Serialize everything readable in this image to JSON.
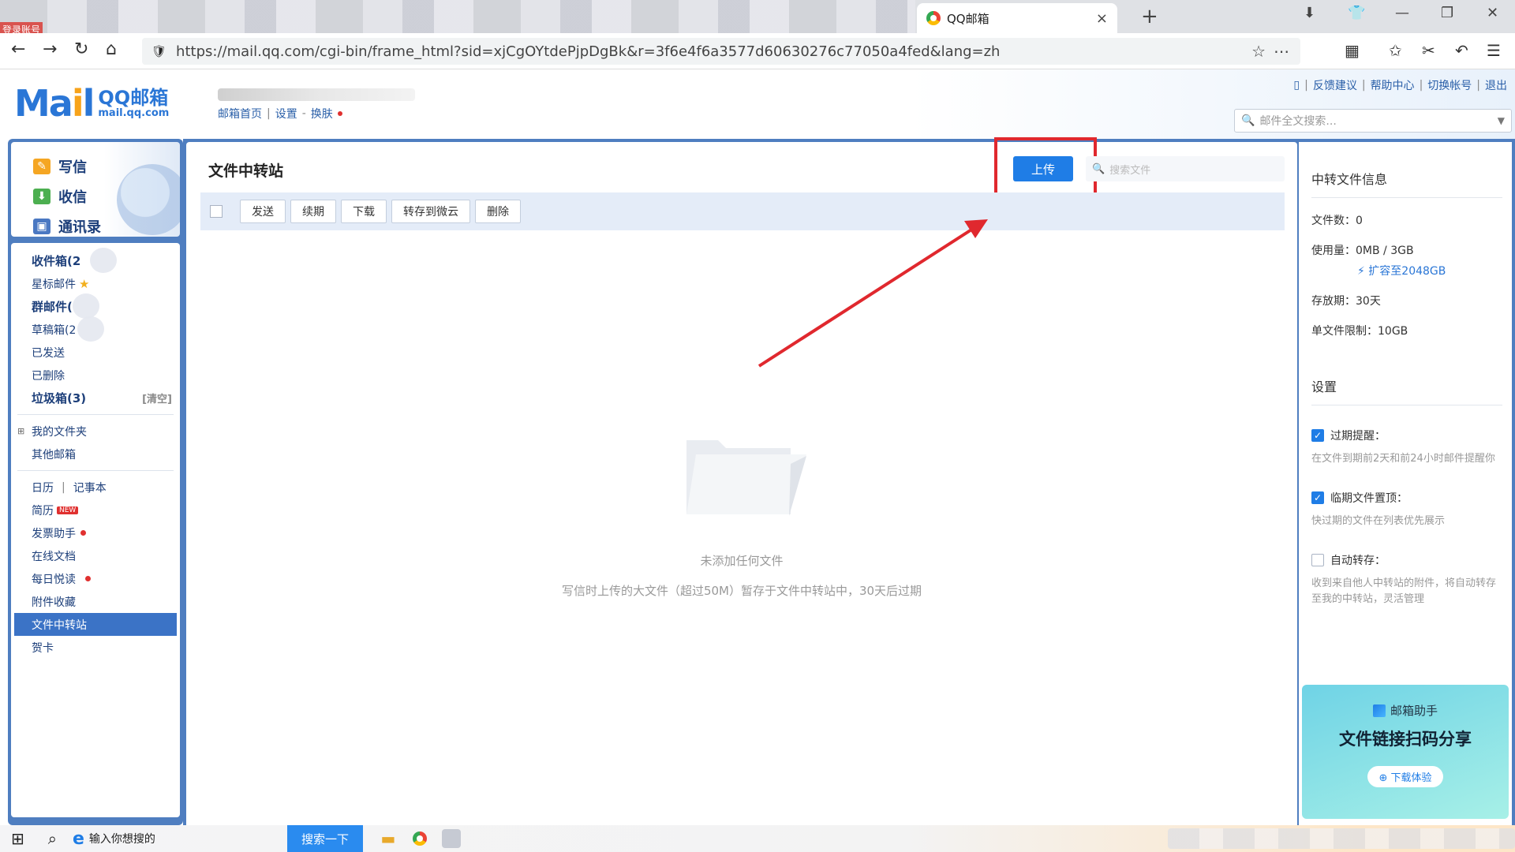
{
  "browser": {
    "login_badge": "登录账号",
    "tab_title": "QQ邮箱",
    "tab_close": "×",
    "new_tab": "+",
    "url": "https://mail.qq.com/cgi-bin/frame_html?sid=xjCgOYtdePjpDgBk&r=3f6e4f6a3577d60630276c77050a4fed&lang=zh"
  },
  "header": {
    "logo_main": "Mail",
    "logo_brand": "QQ邮箱",
    "logo_domain": "mail.qq.com",
    "links": {
      "home": "邮箱首页",
      "settings": "设置",
      "skin": "换肤"
    },
    "top_links": {
      "feedback": "反馈建议",
      "help": "帮助中心",
      "switch": "切换帐号",
      "logout": "退出"
    },
    "search_placeholder": "邮件全文搜索..."
  },
  "sidebar": {
    "quick": {
      "compose": "写信",
      "inbox": "收信",
      "contacts": "通讯录"
    },
    "folders": {
      "inbox": "收件箱(2",
      "starred": "星标邮件",
      "group": "群邮件(",
      "drafts": "草稿箱(2",
      "sent": "已发送",
      "deleted": "已删除",
      "spam": "垃圾箱(3)",
      "spam_clear": "[清空]",
      "my_folders": "我的文件夹",
      "other_mailbox": "其他邮箱",
      "calendar": "日历",
      "notes": "记事本",
      "resume": "简历",
      "new_badge": "NEW",
      "invoice": "发票助手",
      "docs": "在线文档",
      "daily_read": "每日悦读",
      "attachments": "附件收藏",
      "transfer": "文件中转站",
      "cards": "贺卡"
    }
  },
  "main": {
    "title": "文件中转站",
    "upload": "上传",
    "search_placeholder": "搜索文件",
    "toolbar": {
      "send": "发送",
      "renew": "续期",
      "download": "下载",
      "save_cloud": "转存到微云",
      "delete": "删除"
    },
    "empty_title": "未添加任何文件",
    "empty_desc": "写信时上传的大文件（超过50M）暂存于文件中转站中，30天后过期"
  },
  "info": {
    "title": "中转文件信息",
    "file_count": "文件数：0",
    "usage": "使用量：0MB / 3GB",
    "expand": "扩容至2048GB",
    "period": "存放期：30天",
    "limit": "单文件限制：10GB",
    "settings_title": "设置",
    "opt1_label": "过期提醒：",
    "opt1_checked": true,
    "opt1_desc": "在文件到期前2天和前24小时邮件提醒你",
    "opt2_label": "临期文件置顶：",
    "opt2_checked": true,
    "opt2_desc": "快过期的文件在列表优先展示",
    "opt3_label": "自动转存：",
    "opt3_checked": false,
    "opt3_desc": "收到来自他人中转站的附件，将自动转存至我的中转站，灵活管理",
    "promo_sub": "邮箱助手",
    "promo_title": "文件链接扫码分享",
    "promo_btn": "下载体验"
  },
  "taskbar": {
    "search_text": "输入你想搜的",
    "search_btn": "搜索一下"
  },
  "colors": {
    "accent": "#1f7de6",
    "frame": "#4f7ec0",
    "highlight": "#e0282e"
  }
}
